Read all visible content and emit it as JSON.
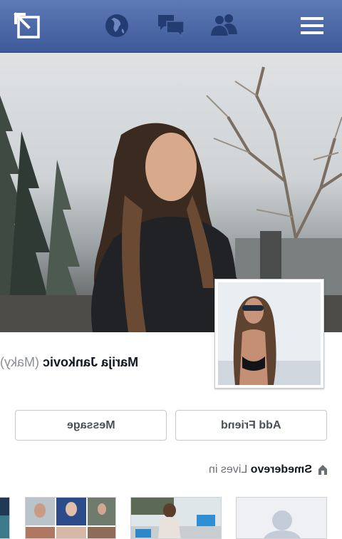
{
  "topbar": {
    "icons": [
      "back-arrow-icon",
      "globe-icon",
      "chat-icon",
      "friends-icon",
      "menu-icon"
    ],
    "color": "#3d5a98"
  },
  "profile": {
    "name": "Marija Jankovic",
    "nickname": "(Maky)"
  },
  "actions": {
    "add_friend_label": "Add Friend",
    "message_label": "Message"
  },
  "about": {
    "lives_prefix": "Lives in",
    "city": "Smederevo"
  },
  "photos": {
    "tiles": [
      "photo-tile-partial",
      "photo-collage-tile",
      "photo-beach-tile",
      "photo-placeholder-tile"
    ]
  }
}
